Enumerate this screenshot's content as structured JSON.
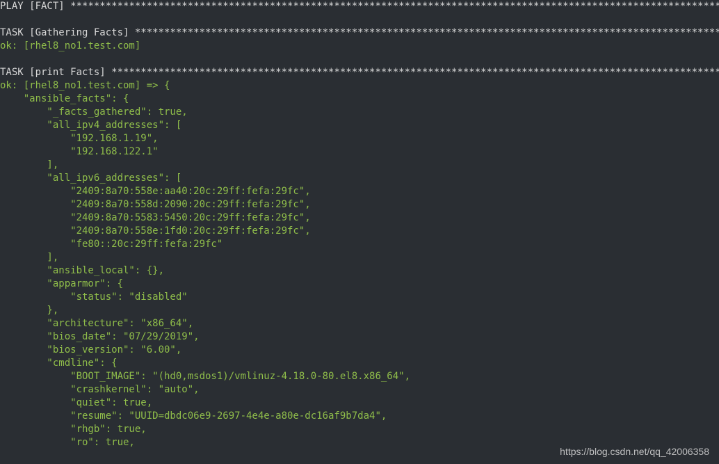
{
  "watermark": "https://blog.csdn.net/qq_42006358",
  "colors": {
    "fg": "#d8d8d8",
    "ok": "#8fbd4a",
    "key": "#8fbd4a",
    "str": "#8fbd4a",
    "plain": "#d8d8d8"
  },
  "lines": [
    {
      "segs": [
        {
          "t": "PLAY [FACT] ",
          "c": "fg"
        },
        {
          "t": "****************************************************************************************************************",
          "c": "fg"
        }
      ]
    },
    {
      "segs": [
        {
          "t": "",
          "c": "fg"
        }
      ]
    },
    {
      "segs": [
        {
          "t": "TASK [Gathering Facts] ",
          "c": "fg"
        },
        {
          "t": "**************************************************************************************************************",
          "c": "fg"
        }
      ]
    },
    {
      "segs": [
        {
          "t": "ok: [rhel8_no1.test.com]",
          "c": "ok"
        }
      ]
    },
    {
      "segs": [
        {
          "t": "",
          "c": "fg"
        }
      ]
    },
    {
      "segs": [
        {
          "t": "TASK [print Facts] ",
          "c": "fg"
        },
        {
          "t": "********************************************************************************************************************",
          "c": "fg"
        }
      ]
    },
    {
      "segs": [
        {
          "t": "ok: [rhel8_no1.test.com] => {",
          "c": "ok"
        }
      ]
    },
    {
      "segs": [
        {
          "t": "    \"ansible_facts\": {",
          "c": "key"
        }
      ]
    },
    {
      "segs": [
        {
          "t": "        \"_facts_gathered\": true,",
          "c": "key"
        }
      ]
    },
    {
      "segs": [
        {
          "t": "        \"all_ipv4_addresses\": [",
          "c": "key"
        }
      ]
    },
    {
      "segs": [
        {
          "t": "            \"192.168.1.19\",",
          "c": "str"
        }
      ]
    },
    {
      "segs": [
        {
          "t": "            \"192.168.122.1\"",
          "c": "str"
        }
      ]
    },
    {
      "segs": [
        {
          "t": "        ],",
          "c": "key"
        }
      ]
    },
    {
      "segs": [
        {
          "t": "        \"all_ipv6_addresses\": [",
          "c": "key"
        }
      ]
    },
    {
      "segs": [
        {
          "t": "            \"2409:8a70:558e:aa40:20c:29ff:fefa:29fc\",",
          "c": "str"
        }
      ]
    },
    {
      "segs": [
        {
          "t": "            \"2409:8a70:558d:2090:20c:29ff:fefa:29fc\",",
          "c": "str"
        }
      ]
    },
    {
      "segs": [
        {
          "t": "            \"2409:8a70:5583:5450:20c:29ff:fefa:29fc\",",
          "c": "str"
        }
      ]
    },
    {
      "segs": [
        {
          "t": "            \"2409:8a70:558e:1fd0:20c:29ff:fefa:29fc\",",
          "c": "str"
        }
      ]
    },
    {
      "segs": [
        {
          "t": "            \"fe80::20c:29ff:fefa:29fc\"",
          "c": "str"
        }
      ]
    },
    {
      "segs": [
        {
          "t": "        ],",
          "c": "key"
        }
      ]
    },
    {
      "segs": [
        {
          "t": "        \"ansible_local\": {},",
          "c": "key"
        }
      ]
    },
    {
      "segs": [
        {
          "t": "        \"apparmor\": {",
          "c": "key"
        }
      ]
    },
    {
      "segs": [
        {
          "t": "            \"status\": \"disabled\"",
          "c": "str"
        }
      ]
    },
    {
      "segs": [
        {
          "t": "        },",
          "c": "key"
        }
      ]
    },
    {
      "segs": [
        {
          "t": "        \"architecture\": \"x86_64\",",
          "c": "key"
        }
      ]
    },
    {
      "segs": [
        {
          "t": "        \"bios_date\": \"07/29/2019\",",
          "c": "key"
        }
      ]
    },
    {
      "segs": [
        {
          "t": "        \"bios_version\": \"6.00\",",
          "c": "key"
        }
      ]
    },
    {
      "segs": [
        {
          "t": "        \"cmdline\": {",
          "c": "key"
        }
      ]
    },
    {
      "segs": [
        {
          "t": "            \"BOOT_IMAGE\": \"(hd0,msdos1)/vmlinuz-4.18.0-80.el8.x86_64\",",
          "c": "str"
        }
      ]
    },
    {
      "segs": [
        {
          "t": "            \"crashkernel\": \"auto\",",
          "c": "str"
        }
      ]
    },
    {
      "segs": [
        {
          "t": "            \"quiet\": true,",
          "c": "str"
        }
      ]
    },
    {
      "segs": [
        {
          "t": "            \"resume\": \"UUID=dbdc06e9-2697-4e4e-a80e-dc16af9b7da4\",",
          "c": "str"
        }
      ]
    },
    {
      "segs": [
        {
          "t": "            \"rhgb\": true,",
          "c": "str"
        }
      ]
    },
    {
      "segs": [
        {
          "t": "            \"ro\": true,",
          "c": "str"
        }
      ]
    }
  ]
}
